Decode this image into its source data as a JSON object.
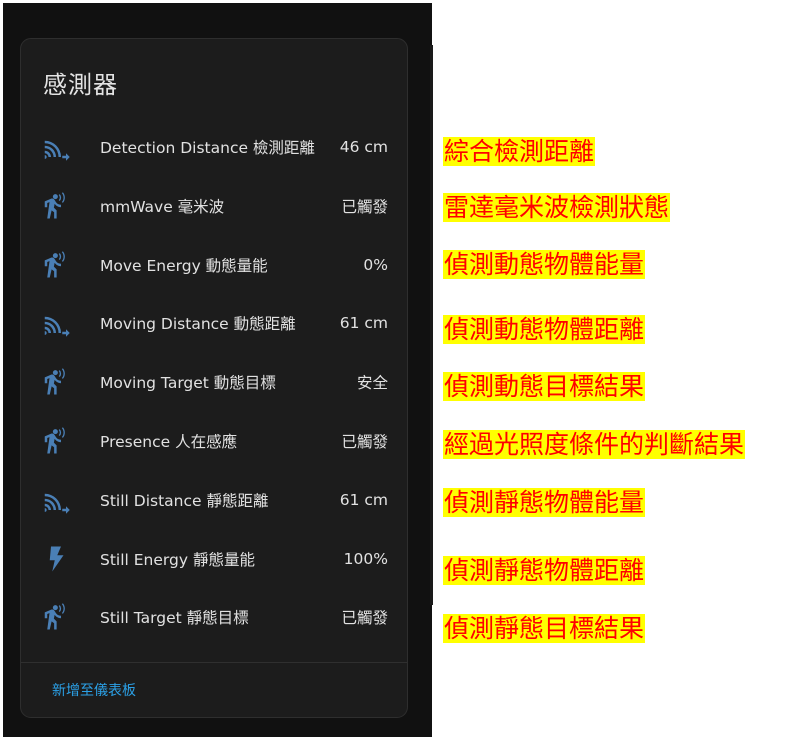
{
  "card": {
    "title": "感測器",
    "add_to_dashboard": "新增至儀表板"
  },
  "sensors": [
    {
      "icon": "signal-distance-icon",
      "name": "Detection Distance 檢測距離",
      "value": "46 cm"
    },
    {
      "icon": "motion-sensor-icon",
      "name": "mmWave 毫米波",
      "value": "已觸發"
    },
    {
      "icon": "motion-sensor-icon",
      "name": "Move Energy 動態量能",
      "value": "0%"
    },
    {
      "icon": "signal-distance-icon",
      "name": "Moving Distance 動態距離",
      "value": "61 cm"
    },
    {
      "icon": "motion-sensor-icon",
      "name": "Moving Target 動態目標",
      "value": "安全"
    },
    {
      "icon": "motion-sensor-icon",
      "name": "Presence 人在感應",
      "value": "已觸發"
    },
    {
      "icon": "signal-distance-icon",
      "name": "Still Distance 靜態距離",
      "value": "61 cm"
    },
    {
      "icon": "lightning-bolt-icon",
      "name": "Still Energy 靜態量能",
      "value": "100%"
    },
    {
      "icon": "motion-sensor-icon",
      "name": "Still Target 靜態目標",
      "value": "已觸發"
    }
  ],
  "annotations": [
    "綜合檢測距離",
    "雷達毫米波檢測狀態",
    "偵測動態物體能量",
    "偵測動態物體距離",
    "偵測動態目標結果",
    "經過光照度條件的判斷結果",
    "偵測靜態物體能量",
    "偵測靜態物體距離",
    "偵測靜態目標結果"
  ],
  "colors": {
    "icon": "#4a7fb5",
    "link": "#2ba0e6",
    "annotation_text": "#ff0000",
    "annotation_bg": "#ffff00"
  }
}
